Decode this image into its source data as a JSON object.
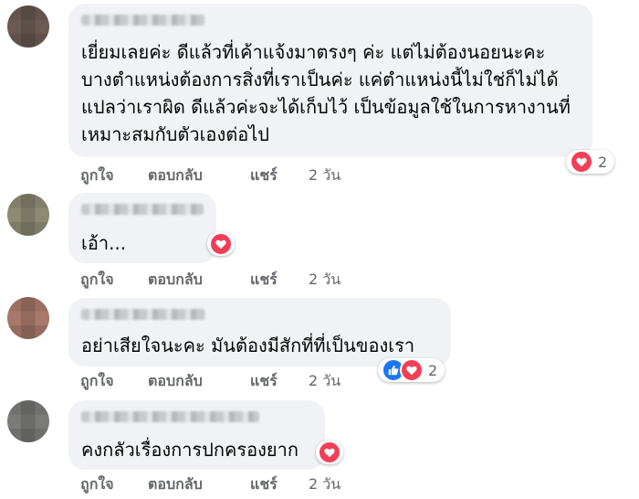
{
  "comments": [
    {
      "text": "เยี่ยมเลยค่ะ ดีแล้วที่เค้าแจ้งมาตรงๆ ค่ะ แต่ไม่ต้องนอยนะคะ\nบางตำแหน่งต้องการสิ่งที่เราเป็นค่ะ แค่ตำแหน่งนี้ไม่ใช่ก็ไม่ได้\nแปลว่าเราผิด ดีแล้วค่ะจะได้เก็บไว้ เป็นข้อมูลใช้ในการหางานที่\nเหมาะสมกับตัวเองต่อไป",
      "like_label": "ถูกใจ",
      "reply_label": "ตอบกลับ",
      "share_label": "แชร์",
      "time": "2 วัน",
      "reactions": [
        "love"
      ],
      "reaction_count": "2",
      "avatar_color": "#6b5a52"
    },
    {
      "text": "เอ้า...",
      "like_label": "ถูกใจ",
      "reply_label": "ตอบกลับ",
      "share_label": "แชร์",
      "time": "2 วัน",
      "reactions": [
        "love"
      ],
      "reaction_count": "",
      "avatar_color": "#8c8a73"
    },
    {
      "text": "อย่าเสียใจนะคะ มันต้องมีสักที่ที่เป็นของเรา",
      "like_label": "ถูกใจ",
      "reply_label": "ตอบกลับ",
      "share_label": "แชร์",
      "time": "2 วัน",
      "reactions": [
        "like",
        "love"
      ],
      "reaction_count": "2",
      "avatar_color": "#a8786a"
    },
    {
      "text": "คงกลัวเรื่องการปกครองยาก",
      "like_label": "ถูกใจ",
      "reply_label": "ตอบกลับ",
      "share_label": "แชร์",
      "time": "2 วัน",
      "reactions": [
        "love"
      ],
      "reaction_count": "",
      "avatar_color": "#7a7a78"
    }
  ],
  "colors": {
    "bubble": "#f0f2f5",
    "meta": "#65676b",
    "love": "#f33e58",
    "like": "#1877f2"
  },
  "icons": {
    "love": "heart-icon",
    "like": "thumbs-up-icon"
  }
}
